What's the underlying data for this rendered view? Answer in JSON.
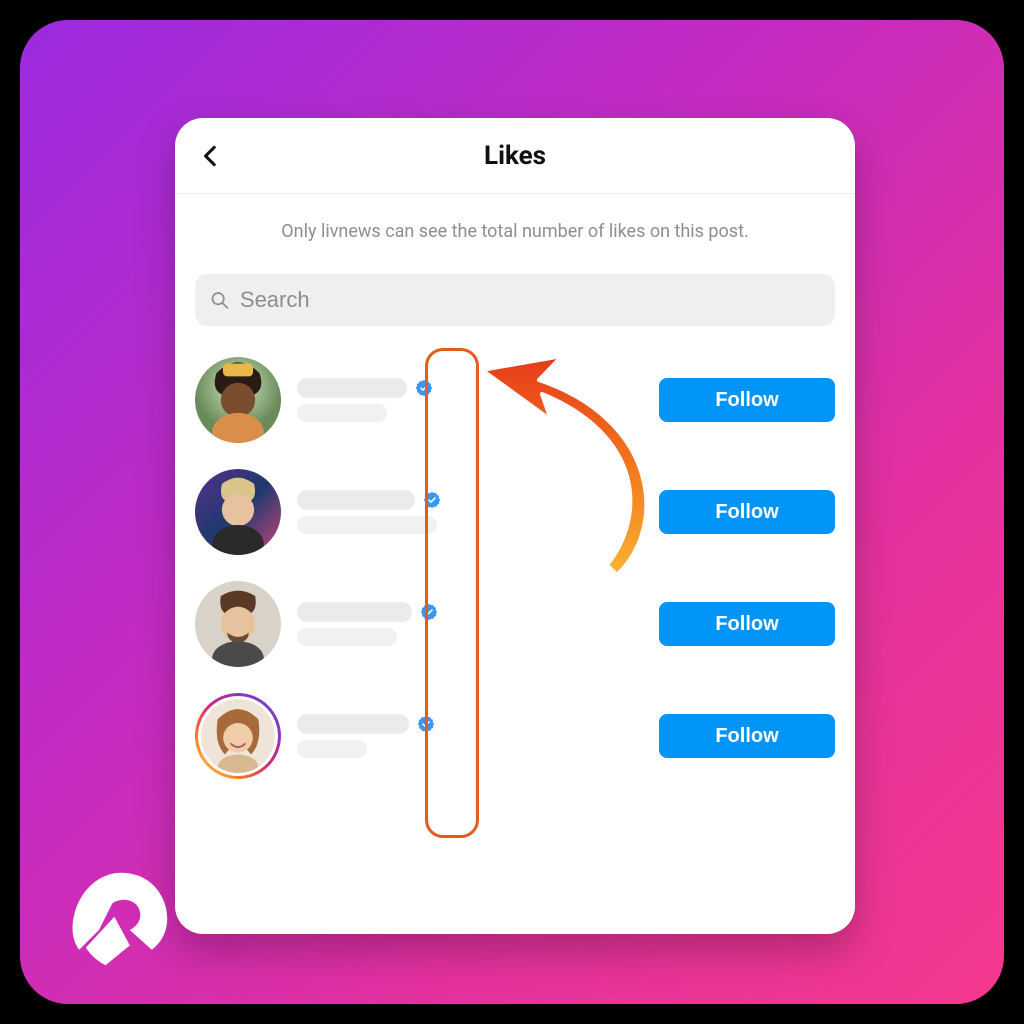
{
  "header": {
    "title": "Likes"
  },
  "notice_text": "Only livnews can see the total number of likes on this post.",
  "search": {
    "placeholder": "Search"
  },
  "follow_label": "Follow",
  "users": [
    {
      "verified": true,
      "story_ring": false
    },
    {
      "verified": true,
      "story_ring": false
    },
    {
      "verified": true,
      "story_ring": false
    },
    {
      "verified": true,
      "story_ring": true
    }
  ],
  "colors": {
    "accent_blue": "#0095f6",
    "highlight_orange": "#e65a1a"
  }
}
